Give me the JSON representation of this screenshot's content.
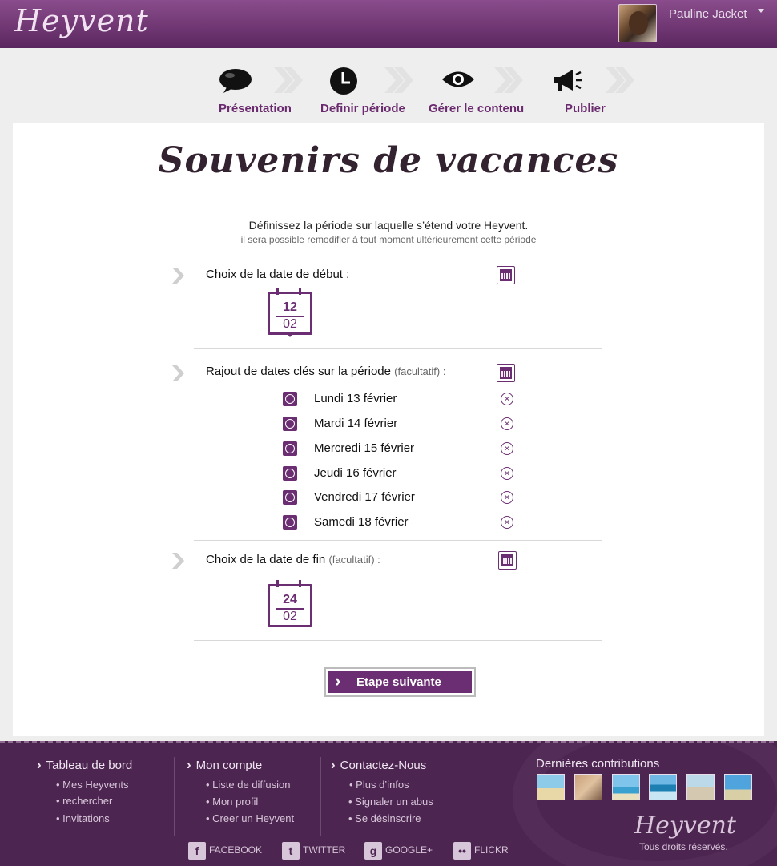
{
  "header": {
    "logo": "Heyvent",
    "user_name": "Pauline Jacket"
  },
  "steps": [
    {
      "label": "Présentation",
      "icon": "speech-bubble-icon"
    },
    {
      "label": "Definir période",
      "icon": "clock-icon"
    },
    {
      "label": "Gérer le contenu",
      "icon": "eye-icon"
    },
    {
      "label": "Publier",
      "icon": "megaphone-icon"
    }
  ],
  "main": {
    "title": "Souvenirs de vacances",
    "intro": "Définissez la période sur laquelle s’étend votre Heyvent.",
    "intro_note": "il sera possible remodifier à tout moment ultérieurement cette période",
    "start": {
      "label": "Choix de la date de début :",
      "day": "12",
      "month": "02"
    },
    "key_dates": {
      "label": "Rajout de dates clés sur la période",
      "optional": "(facultatif) :",
      "items": [
        "Lundi 13 février",
        "Mardi 14 février",
        "Mercredi 15 février",
        "Jeudi 16 février",
        "Vendredi 17 février",
        "Samedi 18 février"
      ]
    },
    "end": {
      "label": "Choix de la date de fin",
      "optional": "(facultatif) :",
      "day": "24",
      "month": "02"
    },
    "next_button": "Etape suivante"
  },
  "footer": {
    "columns": [
      {
        "title": "Tableau de bord",
        "links": [
          "Mes Heyvents",
          "rechercher",
          "Invitations"
        ]
      },
      {
        "title": "Mon compte",
        "links": [
          "Liste de diffusion",
          "Mon profil",
          "Creer un Heyvent"
        ]
      },
      {
        "title": "Contactez-Nous",
        "links": [
          "Plus d’infos",
          "Signaler un abus",
          "Se désinscrire"
        ]
      }
    ],
    "social": [
      "FACEBOOK",
      "TWITTER",
      "GOOGLE+",
      "FLICKR"
    ],
    "contributions_title": "Dernières contributions",
    "logo": "Heyvent",
    "rights": "Tous droits réservés."
  },
  "colors": {
    "brand": "#6b2e72",
    "header_top": "#8a4c8c",
    "header_bottom": "#5b2760",
    "footer": "#4d2551"
  }
}
